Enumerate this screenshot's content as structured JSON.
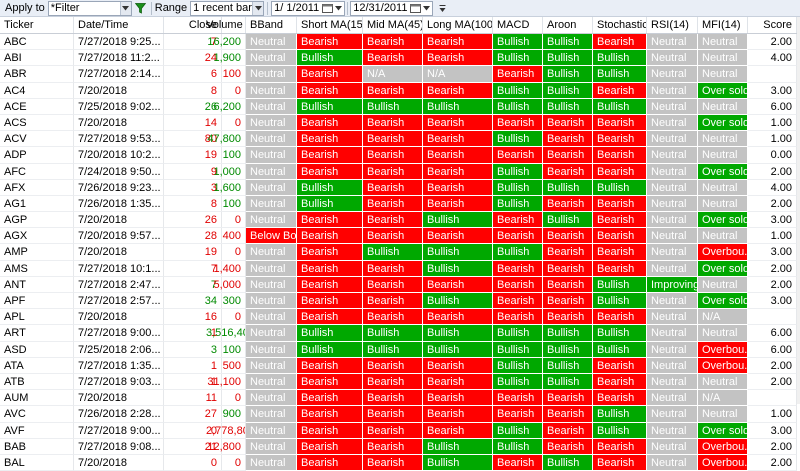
{
  "toolbar": {
    "apply_to_label": "Apply to",
    "filter_value": "*Filter",
    "range_label": "Range",
    "range_value": "1 recent bar(s)",
    "date_from": "1/  1/2011",
    "date_to": "12/31/2011"
  },
  "columns": [
    "Ticker",
    "Date/Time",
    "Close",
    "Volume",
    "BBand",
    "Short MA(15)",
    "Mid MA(45)",
    "Long MA(100)",
    "MACD",
    "Aroon",
    "Stochastic",
    "RSI(14)",
    "MFI(14)",
    "Score"
  ],
  "rows": [
    {
      "ticker": "ABC",
      "date": "7/27/2018 9:25...",
      "close": "7",
      "close_dir": "red",
      "volume": "16,200",
      "vol_dir": "green",
      "bband": "Neutral",
      "short": "Bearish",
      "mid": "Bearish",
      "long": "Bearish",
      "macd": "Bullish",
      "aroon": "Bullish",
      "stoch": "Bearish",
      "rsi": "Neutral",
      "mfi": "Neutral",
      "score": "2.00"
    },
    {
      "ticker": "ABI",
      "date": "7/27/2018 11:2...",
      "close": "24",
      "close_dir": "red",
      "volume": "1,900",
      "vol_dir": "green",
      "bband": "Neutral",
      "short": "Bullish",
      "mid": "Bearish",
      "long": "Bearish",
      "macd": "Bullish",
      "aroon": "Bullish",
      "stoch": "Bullish",
      "rsi": "Neutral",
      "mfi": "Neutral",
      "score": "4.00"
    },
    {
      "ticker": "ABR",
      "date": "7/27/2018 2:14...",
      "close": "6",
      "close_dir": "red",
      "volume": "100",
      "vol_dir": "red",
      "bband": "Neutral",
      "short": "Bearish",
      "mid": "N/A",
      "long": "N/A",
      "macd": "Bearish",
      "aroon": "Bullish",
      "stoch": "Bullish",
      "rsi": "Neutral",
      "mfi": "Neutral",
      "score": ""
    },
    {
      "ticker": "AC4",
      "date": "7/20/2018",
      "close": "8",
      "close_dir": "red",
      "volume": "0",
      "vol_dir": "red",
      "bband": "Neutral",
      "short": "Bearish",
      "mid": "Bearish",
      "long": "Bearish",
      "macd": "Bullish",
      "aroon": "Bullish",
      "stoch": "Bearish",
      "rsi": "Neutral",
      "mfi": "Over sold",
      "score": "3.00"
    },
    {
      "ticker": "ACE",
      "date": "7/25/2018 9:02...",
      "close": "26",
      "close_dir": "green",
      "volume": "6,200",
      "vol_dir": "green",
      "bband": "Neutral",
      "short": "Bullish",
      "mid": "Bullish",
      "long": "Bullish",
      "macd": "Bullish",
      "aroon": "Bullish",
      "stoch": "Bullish",
      "rsi": "Neutral",
      "mfi": "Neutral",
      "score": "6.00"
    },
    {
      "ticker": "ACS",
      "date": "7/20/2018",
      "close": "14",
      "close_dir": "red",
      "volume": "0",
      "vol_dir": "red",
      "bband": "Neutral",
      "short": "Bearish",
      "mid": "Bearish",
      "long": "Bearish",
      "macd": "Bearish",
      "aroon": "Bearish",
      "stoch": "Bearish",
      "rsi": "Neutral",
      "mfi": "Over sold",
      "score": "1.00"
    },
    {
      "ticker": "ACV",
      "date": "7/27/2018 9:53...",
      "close": "80",
      "close_dir": "red",
      "volume": "47,800",
      "vol_dir": "green",
      "bband": "Neutral",
      "short": "Bearish",
      "mid": "Bearish",
      "long": "Bearish",
      "macd": "Bullish",
      "aroon": "Bearish",
      "stoch": "Bearish",
      "rsi": "Neutral",
      "mfi": "Neutral",
      "score": "1.00"
    },
    {
      "ticker": "ADP",
      "date": "7/20/2018 10:2...",
      "close": "19",
      "close_dir": "red",
      "volume": "100",
      "vol_dir": "green",
      "bband": "Neutral",
      "short": "Bearish",
      "mid": "Bearish",
      "long": "Bearish",
      "macd": "Bearish",
      "aroon": "Bearish",
      "stoch": "Bearish",
      "rsi": "Neutral",
      "mfi": "Neutral",
      "score": "0.00"
    },
    {
      "ticker": "AFC",
      "date": "7/24/2018 9:50...",
      "close": "9",
      "close_dir": "red",
      "volume": "1,000",
      "vol_dir": "green",
      "bband": "Neutral",
      "short": "Bearish",
      "mid": "Bearish",
      "long": "Bearish",
      "macd": "Bullish",
      "aroon": "Bearish",
      "stoch": "Bearish",
      "rsi": "Neutral",
      "mfi": "Over sold",
      "score": "2.00"
    },
    {
      "ticker": "AFX",
      "date": "7/26/2018 9:23...",
      "close": "3",
      "close_dir": "red",
      "volume": "1,600",
      "vol_dir": "green",
      "bband": "Neutral",
      "short": "Bullish",
      "mid": "Bearish",
      "long": "Bearish",
      "macd": "Bullish",
      "aroon": "Bullish",
      "stoch": "Bullish",
      "rsi": "Neutral",
      "mfi": "Neutral",
      "score": "4.00"
    },
    {
      "ticker": "AG1",
      "date": "7/26/2018 1:35...",
      "close": "8",
      "close_dir": "red",
      "volume": "100",
      "vol_dir": "green",
      "bband": "Neutral",
      "short": "Bullish",
      "mid": "Bearish",
      "long": "Bearish",
      "macd": "Bullish",
      "aroon": "Bearish",
      "stoch": "Bearish",
      "rsi": "Neutral",
      "mfi": "Neutral",
      "score": "2.00"
    },
    {
      "ticker": "AGP",
      "date": "7/20/2018",
      "close": "26",
      "close_dir": "red",
      "volume": "0",
      "vol_dir": "red",
      "bband": "Neutral",
      "short": "Bearish",
      "mid": "Bearish",
      "long": "Bullish",
      "macd": "Bearish",
      "aroon": "Bullish",
      "stoch": "Bearish",
      "rsi": "Neutral",
      "mfi": "Over sold",
      "score": "3.00"
    },
    {
      "ticker": "AGX",
      "date": "7/20/2018 9:57...",
      "close": "28",
      "close_dir": "red",
      "volume": "400",
      "vol_dir": "red",
      "bband": "Below Bo...",
      "short": "Bearish",
      "mid": "Bearish",
      "long": "Bearish",
      "macd": "Bearish",
      "aroon": "Bearish",
      "stoch": "Bearish",
      "rsi": "Neutral",
      "mfi": "Neutral",
      "score": "1.00"
    },
    {
      "ticker": "AMP",
      "date": "7/20/2018",
      "close": "19",
      "close_dir": "red",
      "volume": "0",
      "vol_dir": "red",
      "bband": "Neutral",
      "short": "Bearish",
      "mid": "Bullish",
      "long": "Bullish",
      "macd": "Bullish",
      "aroon": "Bearish",
      "stoch": "Bearish",
      "rsi": "Neutral",
      "mfi": "Overbou...",
      "score": "3.00"
    },
    {
      "ticker": "AMS",
      "date": "7/27/2018 10:1...",
      "close": "7",
      "close_dir": "red",
      "volume": "1,400",
      "vol_dir": "red",
      "bband": "Neutral",
      "short": "Bearish",
      "mid": "Bearish",
      "long": "Bullish",
      "macd": "Bearish",
      "aroon": "Bearish",
      "stoch": "Bearish",
      "rsi": "Neutral",
      "mfi": "Over sold",
      "score": "2.00"
    },
    {
      "ticker": "ANT",
      "date": "7/27/2018 2:47...",
      "close": "7",
      "close_dir": "green",
      "volume": "5,000",
      "vol_dir": "red",
      "bband": "Neutral",
      "short": "Bearish",
      "mid": "Bearish",
      "long": "Bearish",
      "macd": "Bearish",
      "aroon": "Bearish",
      "stoch": "Bullish",
      "rsi": "Improving",
      "mfi": "Neutral",
      "score": "2.00"
    },
    {
      "ticker": "APF",
      "date": "7/27/2018 2:57...",
      "close": "34",
      "close_dir": "green",
      "volume": "300",
      "vol_dir": "green",
      "bband": "Neutral",
      "short": "Bearish",
      "mid": "Bearish",
      "long": "Bullish",
      "macd": "Bearish",
      "aroon": "Bearish",
      "stoch": "Bullish",
      "rsi": "Neutral",
      "mfi": "Over sold",
      "score": "3.00"
    },
    {
      "ticker": "APL",
      "date": "7/20/2018",
      "close": "16",
      "close_dir": "red",
      "volume": "0",
      "vol_dir": "red",
      "bband": "Neutral",
      "short": "Bearish",
      "mid": "Bearish",
      "long": "Bearish",
      "macd": "Bearish",
      "aroon": "Bearish",
      "stoch": "Bearish",
      "rsi": "Neutral",
      "mfi": "N/A",
      "score": ""
    },
    {
      "ticker": "ART",
      "date": "7/27/2018 9:00...",
      "close": "1",
      "close_dir": "red",
      "volume": "3,516,400",
      "vol_dir": "green",
      "bband": "Neutral",
      "short": "Bullish",
      "mid": "Bullish",
      "long": "Bullish",
      "macd": "Bullish",
      "aroon": "Bullish",
      "stoch": "Bullish",
      "rsi": "Neutral",
      "mfi": "Neutral",
      "score": "6.00"
    },
    {
      "ticker": "ASD",
      "date": "7/25/2018 2:06...",
      "close": "3",
      "close_dir": "green",
      "volume": "100",
      "vol_dir": "green",
      "bband": "Neutral",
      "short": "Bullish",
      "mid": "Bullish",
      "long": "Bullish",
      "macd": "Bullish",
      "aroon": "Bullish",
      "stoch": "Bullish",
      "rsi": "Neutral",
      "mfi": "Overbou...",
      "score": "6.00"
    },
    {
      "ticker": "ATA",
      "date": "7/27/2018 1:35...",
      "close": "1",
      "close_dir": "red",
      "volume": "500",
      "vol_dir": "red",
      "bband": "Neutral",
      "short": "Bearish",
      "mid": "Bearish",
      "long": "Bearish",
      "macd": "Bullish",
      "aroon": "Bullish",
      "stoch": "Bearish",
      "rsi": "Neutral",
      "mfi": "Overbou...",
      "score": "2.00"
    },
    {
      "ticker": "ATB",
      "date": "7/27/2018 9:03...",
      "close": "1",
      "close_dir": "red",
      "volume": "31,100",
      "vol_dir": "red",
      "bband": "Neutral",
      "short": "Bearish",
      "mid": "Bearish",
      "long": "Bearish",
      "macd": "Bullish",
      "aroon": "Bullish",
      "stoch": "Bearish",
      "rsi": "Neutral",
      "mfi": "Neutral",
      "score": "2.00"
    },
    {
      "ticker": "AUM",
      "date": "7/20/2018",
      "close": "11",
      "close_dir": "red",
      "volume": "0",
      "vol_dir": "red",
      "bband": "Neutral",
      "short": "Bearish",
      "mid": "Bearish",
      "long": "Bearish",
      "macd": "Bearish",
      "aroon": "Bearish",
      "stoch": "Bearish",
      "rsi": "Neutral",
      "mfi": "N/A",
      "score": ""
    },
    {
      "ticker": "AVC",
      "date": "7/26/2018 2:28...",
      "close": "27",
      "close_dir": "red",
      "volume": "900",
      "vol_dir": "green",
      "bband": "Neutral",
      "short": "Bearish",
      "mid": "Bearish",
      "long": "Bearish",
      "macd": "Bearish",
      "aroon": "Bearish",
      "stoch": "Bullish",
      "rsi": "Neutral",
      "mfi": "Neutral",
      "score": "1.00"
    },
    {
      "ticker": "AVF",
      "date": "7/27/2018 9:00...",
      "close": "0",
      "close_dir": "red",
      "volume": "2,778,800",
      "vol_dir": "red",
      "bband": "Neutral",
      "short": "Bearish",
      "mid": "Bearish",
      "long": "Bearish",
      "macd": "Bullish",
      "aroon": "Bearish",
      "stoch": "Bullish",
      "rsi": "Neutral",
      "mfi": "Over sold",
      "score": "3.00"
    },
    {
      "ticker": "BAB",
      "date": "7/27/2018 9:08...",
      "close": "21",
      "close_dir": "red",
      "volume": "12,800",
      "vol_dir": "red",
      "bband": "Neutral",
      "short": "Bearish",
      "mid": "Bearish",
      "long": "Bullish",
      "macd": "Bullish",
      "aroon": "Bearish",
      "stoch": "Bearish",
      "rsi": "Neutral",
      "mfi": "Overbou...",
      "score": "2.00"
    },
    {
      "ticker": "BAL",
      "date": "7/20/2018",
      "close": "0",
      "close_dir": "red",
      "volume": "0",
      "vol_dir": "red",
      "bband": "Neutral",
      "short": "Bearish",
      "mid": "Bearish",
      "long": "Bullish",
      "macd": "Bearish",
      "aroon": "Bullish",
      "stoch": "Bearish",
      "rsi": "Neutral",
      "mfi": "Overbou...",
      "score": "2.00"
    }
  ],
  "colors": {
    "bullish": "#00a800",
    "bearish": "#ff0000",
    "neutral": "#c3c3c3"
  }
}
